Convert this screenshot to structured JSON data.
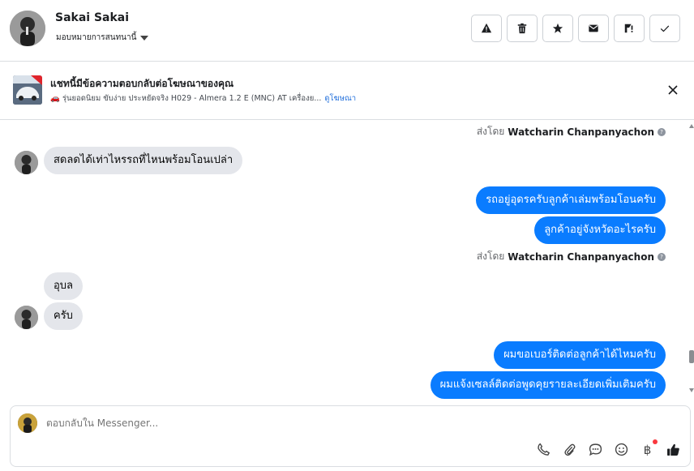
{
  "header": {
    "contact_name": "Sakai Sakai",
    "assign_label": "มอบหมายการสนทนานี้",
    "actions": [
      {
        "icon": "warning-icon"
      },
      {
        "icon": "trash-icon"
      },
      {
        "icon": "star-icon"
      },
      {
        "icon": "mail-icon"
      },
      {
        "icon": "follow-up-icon"
      },
      {
        "icon": "check-icon"
      }
    ]
  },
  "ad": {
    "title": "แชทนี้มีข้อความตอบกลับต่อโฆษณาของคุณ",
    "description": "🚗 รุ่นยอดนิยม ขับง่าย ประหยัดจริง H029 - Almera 1.2 E (MNC) AT เครื่องย...",
    "link": "ดูโฆษณา"
  },
  "messages": {
    "sent_by_prefix": "ส่งโดย",
    "agent_name": "Watcharin Chanpanyachon",
    "in_1": "สดลดได้เท่าไหรรถที่ไหนพร้อมโอนเปล่า",
    "out_1": "รถอยู่อุดรครับลูกค้าเล่มพร้อมโอนครับ",
    "out_2": "ลูกค้าอยู่จังหวัดอะไรครับ",
    "in_2": "อุบล",
    "in_3": "ครับ",
    "out_3": "ผมขอเบอร์ติดต่อลูกค้าได้ไหมครับ",
    "out_4": "ผมแจ้งเซลล์ติดต่อพูดคุยรายละเอียดเพิ่มเติมครับ"
  },
  "composer": {
    "placeholder": "ตอบกลับใน Messenger...",
    "tools": [
      "phone-icon",
      "attachment-icon",
      "chat-bubble-icon",
      "emoji-icon",
      "baht-icon",
      "thumbs-up-icon"
    ],
    "baht_symbol": "฿"
  },
  "colors": {
    "outgoing_bubble": "#0a7cff",
    "incoming_bubble": "#e4e6eb",
    "link": "#216fdb",
    "notification_dot": "#fa383e"
  }
}
